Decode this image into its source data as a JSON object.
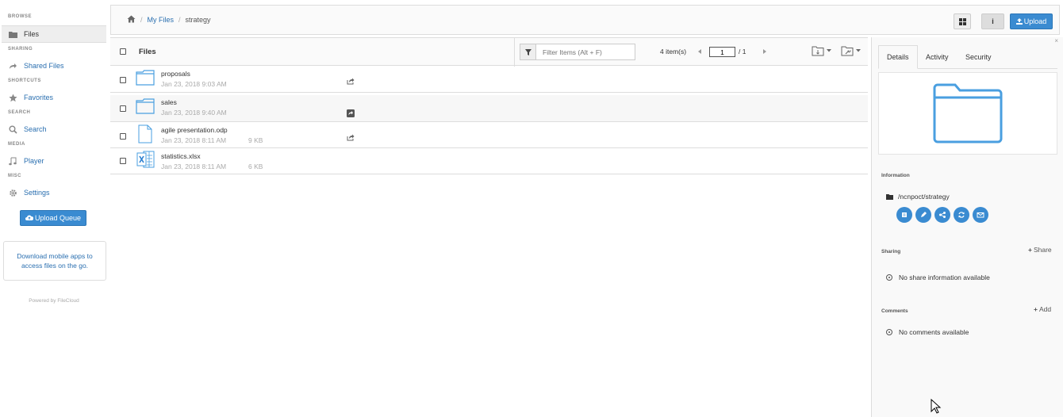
{
  "sidebar": {
    "sections": {
      "browse": "BROWSE",
      "sharing": "SHARING",
      "shortcuts": "SHORTCUTS",
      "search": "SEARCH",
      "media": "MEDIA",
      "misc": "MISC"
    },
    "items": {
      "files": "Files",
      "shared_files": "Shared Files",
      "favorites": "Favorites",
      "search": "Search",
      "player": "Player",
      "settings": "Settings"
    },
    "upload_queue": "Upload Queue",
    "promo": "Download mobile apps to access files on the go.",
    "powered_by": "Powered by FileCloud"
  },
  "topbar": {
    "breadcrumb": {
      "sep": "/",
      "my_files": "My Files",
      "current": "strategy"
    },
    "info_label": "i",
    "upload_label": "Upload"
  },
  "file_list": {
    "header": {
      "title": "Files",
      "filter_placeholder": "Filter Items (Alt + F)",
      "count": "4 item(s)",
      "page_value": "1",
      "page_total": "/ 1"
    },
    "rows": [
      {
        "name": "proposals",
        "date": "Jan 23, 2018 9:03 AM",
        "size": "",
        "type": "folder"
      },
      {
        "name": "sales",
        "date": "Jan 23, 2018 9:40 AM",
        "size": "",
        "type": "folder"
      },
      {
        "name": "agile presentation.odp",
        "date": "Jan 23, 2018 8:11 AM",
        "size": "9 KB",
        "type": "document"
      },
      {
        "name": "statistics.xlsx",
        "date": "Jan 23, 2018 8:11 AM",
        "size": "6 KB",
        "type": "excel"
      }
    ]
  },
  "right_panel": {
    "close": "×",
    "tabs": {
      "details": "Details",
      "activity": "Activity",
      "security": "Security"
    },
    "information_label": "Information",
    "path": "/ncnpoct/strategy",
    "sharing_label": "Sharing",
    "share_link": "Share",
    "no_share": "No share information available",
    "comments_label": "Comments",
    "add_link": "Add",
    "no_comments": "No comments available"
  },
  "colors": {
    "accent": "#3a8bd1",
    "folder": "#4a9fe0",
    "link": "#2a6fb0"
  }
}
